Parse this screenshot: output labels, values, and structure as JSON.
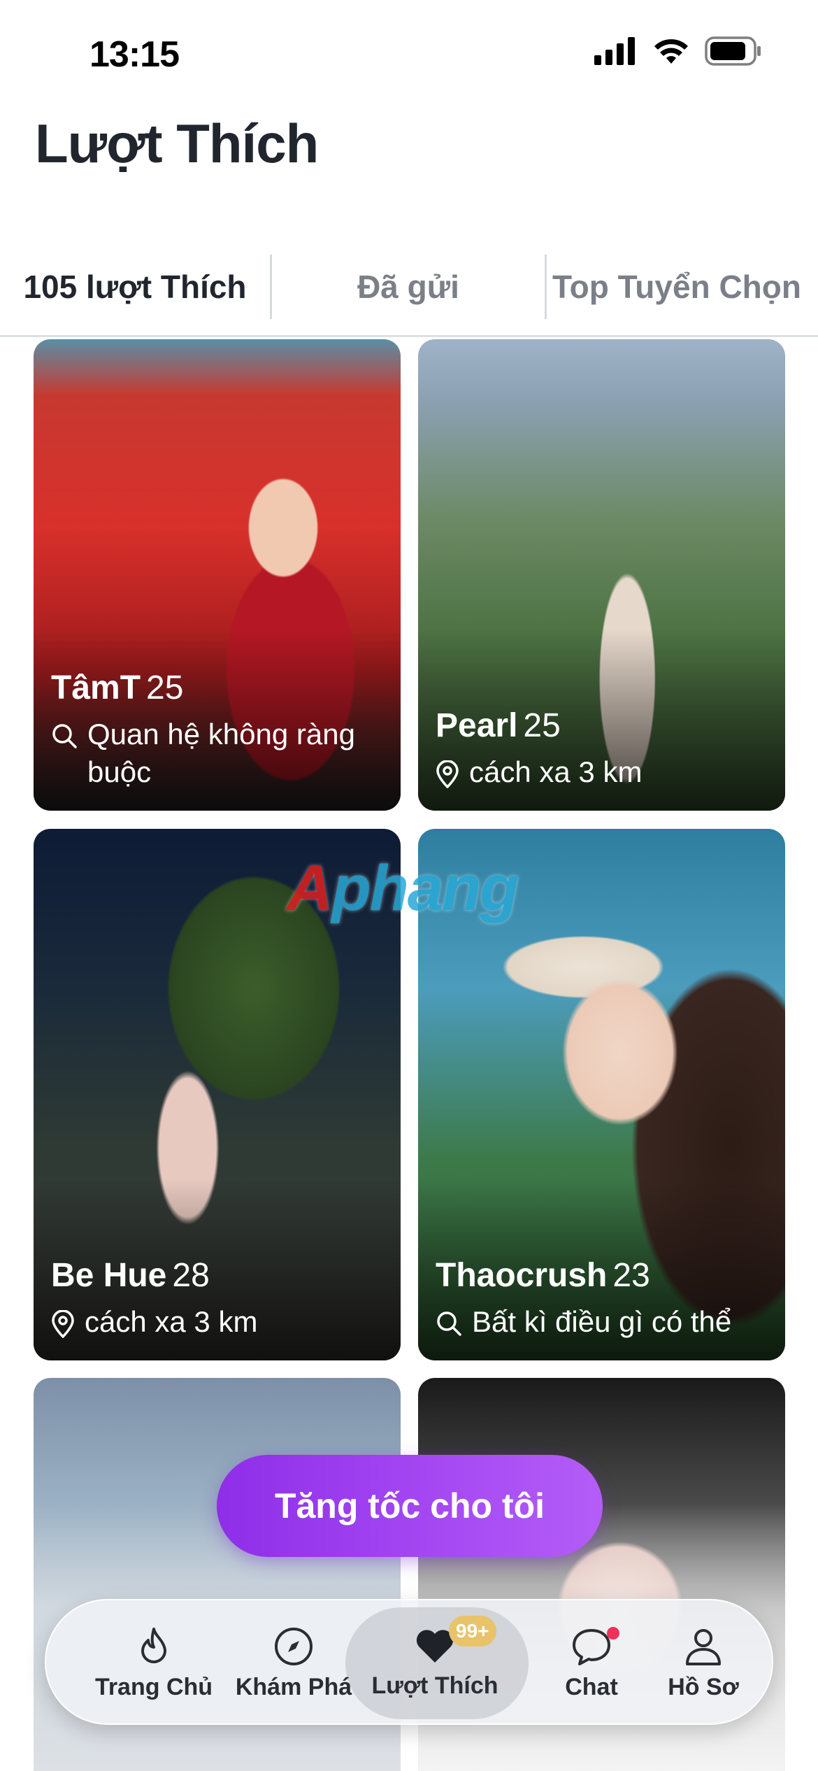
{
  "status_bar": {
    "time": "13:15"
  },
  "page_title": "Lượt Thích",
  "tabs": [
    {
      "label": "105 lượt Thích",
      "active": true
    },
    {
      "label": "Đã gửi",
      "active": false
    },
    {
      "label": "Top Tuyển Chọn",
      "active": false
    }
  ],
  "cards": [
    {
      "name": "TâmT",
      "age": "25",
      "meta_icon": "search-icon",
      "meta": "Quan hệ không ràng buộc"
    },
    {
      "name": "Pearl",
      "age": "25",
      "meta_icon": "location-pin-icon",
      "meta": "cách xa 3 km"
    },
    {
      "name": "Be Hue",
      "age": "28",
      "meta_icon": "location-pin-icon",
      "meta": "cách xa 3 km"
    },
    {
      "name": "Thaocrush",
      "age": "23",
      "meta_icon": "search-icon",
      "meta": "Bất kì điều gì có thể"
    },
    {
      "name": "",
      "age": "",
      "meta_icon": "",
      "meta": ""
    },
    {
      "name": "",
      "age": "",
      "meta_icon": "",
      "meta": ""
    }
  ],
  "watermark": {
    "first_letter": "A",
    "rest": "phang"
  },
  "boost_button": {
    "label": "Tăng tốc cho tôi"
  },
  "bottom_nav": {
    "items": [
      {
        "label": "Trang Chủ",
        "icon": "flame-icon"
      },
      {
        "label": "Khám Phá",
        "icon": "compass-icon"
      },
      {
        "label": "Lượt Thích",
        "icon": "heart-icon",
        "badge": "99+",
        "active": true
      },
      {
        "label": "Chat",
        "icon": "chat-bubble-icon"
      },
      {
        "label": "Hồ Sơ",
        "icon": "person-icon"
      }
    ]
  },
  "colors": {
    "accent_purple": "#9b3cef",
    "badge_gold": "#e8c36a",
    "notification_red": "#f0305a"
  }
}
